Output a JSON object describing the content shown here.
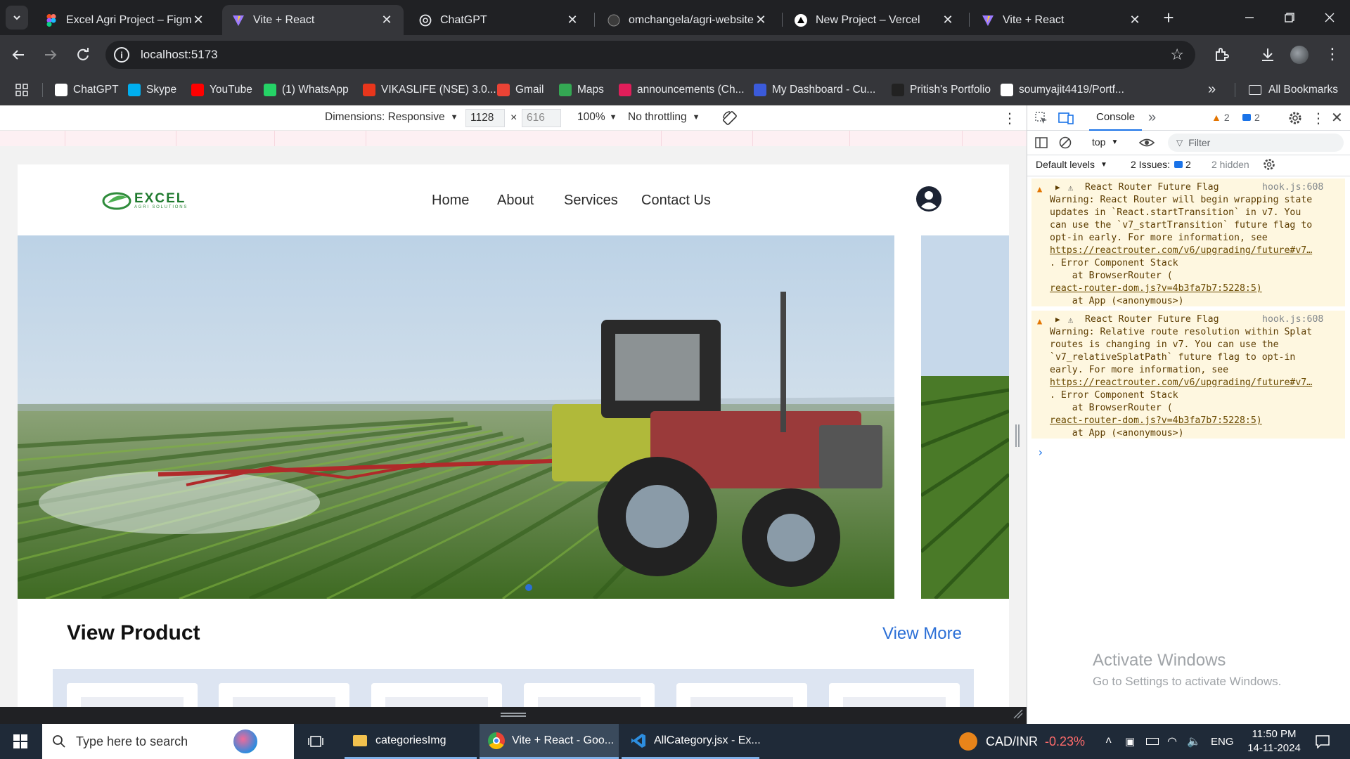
{
  "browser": {
    "tabs": [
      {
        "title": "Excel Agri Project – Figma",
        "icon": "figma-icon"
      },
      {
        "title": "Vite + React",
        "icon": "vite-icon",
        "active": true
      },
      {
        "title": "ChatGPT",
        "icon": "chatgpt-icon"
      },
      {
        "title": "omchangela/agri-website",
        "icon": "github-icon"
      },
      {
        "title": "New Project – Vercel",
        "icon": "vercel-icon"
      },
      {
        "title": "Vite + React",
        "icon": "vite-icon"
      }
    ],
    "url": "localhost:5173",
    "bookmarks": [
      {
        "label": "ChatGPT",
        "color": "#ffffff"
      },
      {
        "label": "Skype",
        "color": "#00aff0"
      },
      {
        "label": "YouTube",
        "color": "#ff0000"
      },
      {
        "label": "(1) WhatsApp",
        "color": "#25d366"
      },
      {
        "label": "VIKASLIFE (NSE) 3.0...",
        "color": "#e8361c"
      },
      {
        "label": "Gmail",
        "color": "#ea4335"
      },
      {
        "label": "Maps",
        "color": "#34a853"
      },
      {
        "label": "announcements (Ch...",
        "color": "#e01e5a"
      },
      {
        "label": "My Dashboard - Cu...",
        "color": "#3b5bdb"
      },
      {
        "label": "Pritish's Portfolio",
        "color": "#222222"
      },
      {
        "label": "soumyajit4419/Portf...",
        "color": "#ffffff"
      }
    ],
    "all_bookmarks": "All Bookmarks"
  },
  "device_toolbar": {
    "dimensions": "Dimensions: Responsive",
    "width": "1128",
    "height": "616",
    "times": "×",
    "zoom": "100%",
    "throttling": "No throttling"
  },
  "site": {
    "logo_word": "EXCEL",
    "logo_sub": "AGRI SOLUTIONS",
    "nav": [
      "Home",
      "About",
      "Services",
      "Contact Us"
    ],
    "section_title": "View Product",
    "view_more": "View More"
  },
  "devtools": {
    "tab_console": "Console",
    "warn_count": "2",
    "msg_count": "2",
    "context": "top",
    "filter_placeholder": "Filter",
    "levels": "Default levels",
    "issues_label": "2 Issues:",
    "issues_count": "2",
    "hidden": "2 hidden",
    "messages": [
      {
        "title": "React Router Future Flag",
        "source": "hook.js:608",
        "lines": [
          "Warning: React Router will begin wrapping state",
          "updates in `React.startTransition` in v7. You",
          "can use the `v7_startTransition` future flag to",
          "opt-in early. For more information, see"
        ],
        "link": "https://reactrouter.com/v6/upgrading/future#v7…",
        "stack": ". Error Component Stack",
        "at1": "    at BrowserRouter (",
        "link2": "react-router-dom.js?v=4b3fa7b7:5228:5)",
        "at2": "    at App (<anonymous>)"
      },
      {
        "title": "React Router Future Flag",
        "source": "hook.js:608",
        "lines": [
          "Warning: Relative route resolution within Splat",
          "routes is changing in v7. You can use the",
          "`v7_relativeSplatPath` future flag to opt-in",
          "early. For more information, see"
        ],
        "link": "https://reactrouter.com/v6/upgrading/future#v7…",
        "stack": ". Error Component Stack",
        "at1": "    at BrowserRouter (",
        "link2": "react-router-dom.js?v=4b3fa7b7:5228:5)",
        "at2": "    at App (<anonymous>)"
      }
    ],
    "prompt": "›"
  },
  "watermark": {
    "title": "Activate Windows",
    "subtitle": "Go to Settings to activate Windows."
  },
  "taskbar": {
    "search": "Type here to search",
    "apps": [
      {
        "label": "categoriesImg",
        "icon": "folder-icon"
      },
      {
        "label": "Vite + React - Goo...",
        "icon": "chrome-icon"
      },
      {
        "label": "AllCategory.jsx - Ex...",
        "icon": "vscode-icon"
      }
    ],
    "ticker_label": "CAD/INR",
    "ticker_value": "-0.23%",
    "lang": "ENG",
    "time": "11:50 PM",
    "date": "14-11-2024"
  }
}
